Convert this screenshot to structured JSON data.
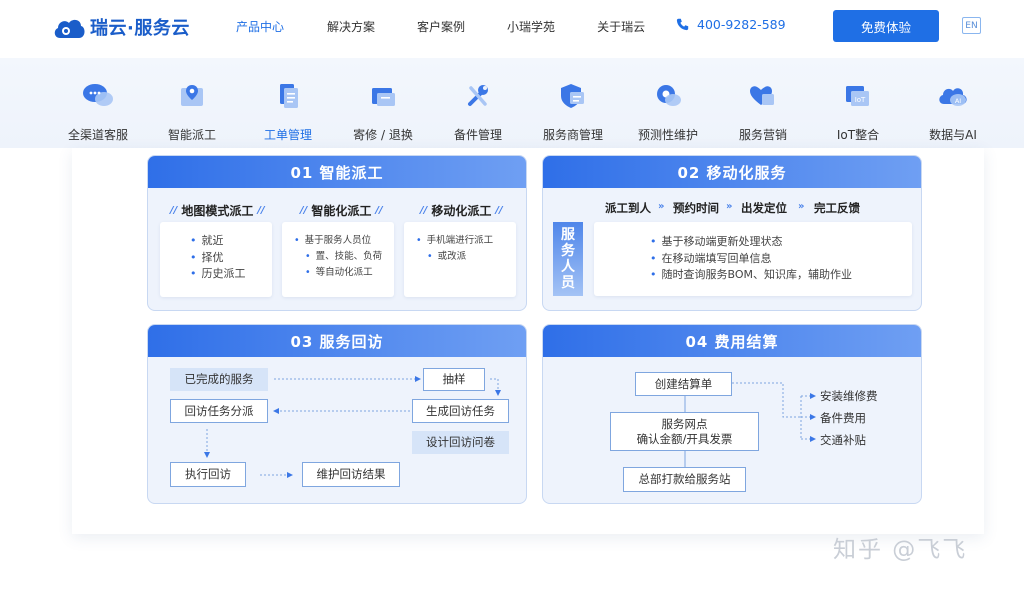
{
  "header": {
    "logo_text": "瑞云·服务云",
    "nav": [
      "产品中心",
      "解决方案",
      "客户案例",
      "小瑞学苑",
      "关于瑞云"
    ],
    "active_nav": "产品中心",
    "phone": "400-9282-589",
    "cta_label": "免费体验",
    "lang_label": "EN",
    "brand_color": "#1f6fe5"
  },
  "products": [
    {
      "label": "全渠道客服",
      "icon": "chat-cloud-icon"
    },
    {
      "label": "智能派工",
      "icon": "map-pin-icon"
    },
    {
      "label": "工单管理",
      "icon": "document-icon",
      "active": true
    },
    {
      "label": "寄修 / 退换",
      "icon": "package-icon"
    },
    {
      "label": "备件管理",
      "icon": "wrench-icon"
    },
    {
      "label": "服务商管理",
      "icon": "shield-icon"
    },
    {
      "label": "预测性维护",
      "icon": "gear-cloud-icon"
    },
    {
      "label": "服务营销",
      "icon": "heart-icon"
    },
    {
      "label": "IoT整合",
      "icon": "iot-icon"
    },
    {
      "label": "数据与AI",
      "icon": "ai-cloud-icon"
    }
  ],
  "cards": {
    "dispatch": {
      "title": "01 智能派工",
      "columns": [
        {
          "title": "地图模式派工",
          "items": [
            "就近",
            "择优",
            "历史派工"
          ]
        },
        {
          "title": "智能化派工",
          "items": [
            "基于服务人员位",
            "置、技能、负荷",
            "等自动化派工"
          ]
        },
        {
          "title": "移动化派工",
          "items": [
            "手机端进行派工",
            "或改派"
          ]
        }
      ]
    },
    "mobile": {
      "title": "02 移动化服务",
      "steps": [
        "派工到人",
        "预约时间",
        "出发定位",
        "完工反馈"
      ],
      "side_label": [
        "服",
        "务",
        "人",
        "员"
      ],
      "items": [
        "基于移动端更新处理状态",
        "在移动端填写回单信息",
        "随时查询服务BOM、知识库，辅助作业"
      ]
    },
    "revisit": {
      "title": "03 服务回访",
      "boxes": {
        "completed": "已完成的服务",
        "sample": "抽样",
        "assign": "回访任务分派",
        "generate": "生成回访任务",
        "questionnaire": "设计回访问卷",
        "execute": "执行回访",
        "maintain": "维护回访结果"
      }
    },
    "billing": {
      "title": "04 费用结算",
      "boxes": {
        "create": "创建结算单",
        "outlet_1": "服务网点",
        "outlet_2": "确认金额/开具发票",
        "pay": "总部打款给服务站"
      },
      "options": [
        "安装维修费",
        "备件费用",
        "交通补贴"
      ]
    }
  },
  "watermark": "知乎 @飞飞"
}
